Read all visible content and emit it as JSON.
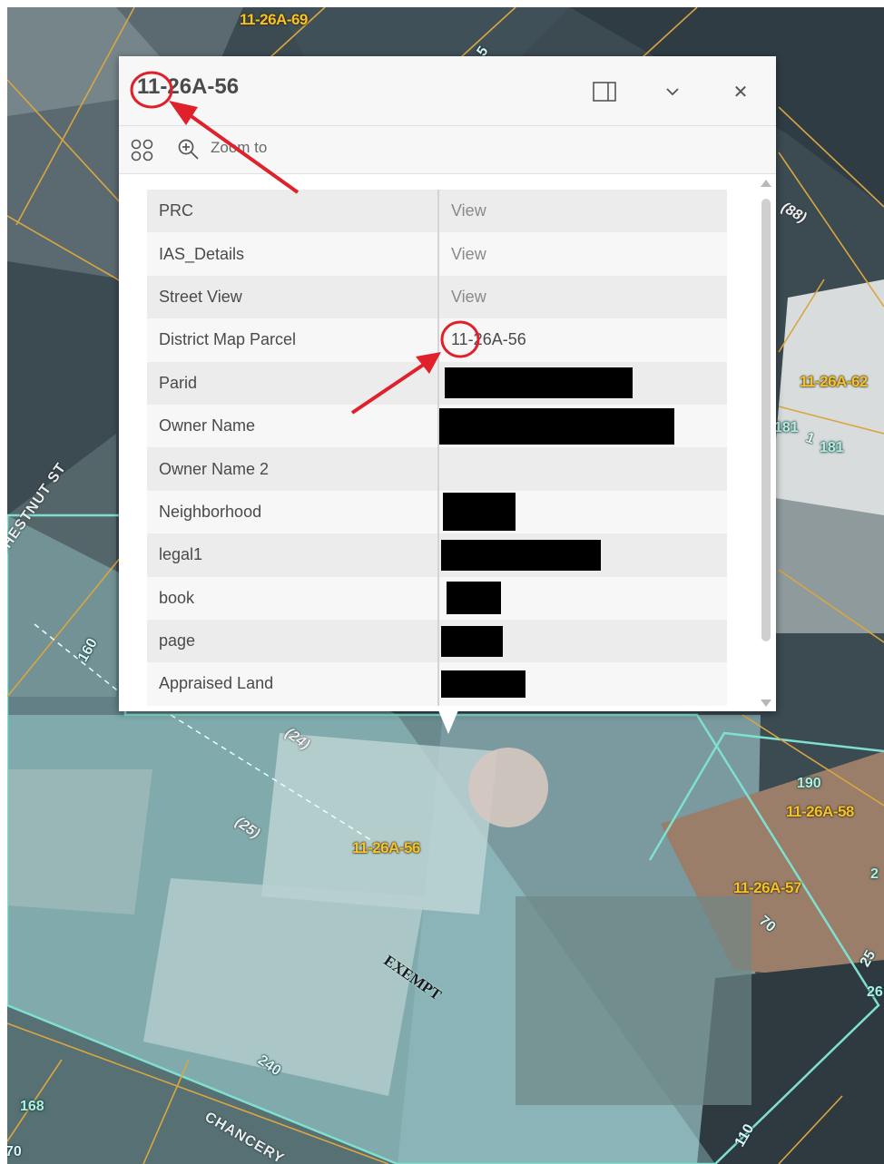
{
  "map": {
    "parcel_labels": [
      "11-26A-69",
      "11-26A-62",
      "11-26A-56",
      "11-26A-58",
      "11-26A-57"
    ],
    "address_labels": [
      "181",
      "181",
      "190",
      "168",
      "70",
      "70",
      "25",
      "26",
      "2",
      "5",
      "1"
    ],
    "lot_labels": [
      "(88)",
      "(24)",
      "(25)"
    ],
    "street_labels": [
      "CHESTNUT ST",
      "CHANCERY"
    ],
    "number_labels": [
      "160",
      "240",
      "110"
    ],
    "exempt_label": "EXEMPT"
  },
  "popup": {
    "title": "11-26A-56",
    "dock_icon": "dock-side-icon",
    "collapse_icon": "chevron-down-icon",
    "close_icon": "close-icon",
    "close_glyph": "✕",
    "toolbar": {
      "actions_icon": "actions-grid-icon",
      "zoom_icon": "zoom-in-icon",
      "zoom_label": "Zoom to"
    },
    "rows": [
      {
        "key": "PRC",
        "value": "View"
      },
      {
        "key": "IAS_Details",
        "value": "View"
      },
      {
        "key": "Street View",
        "value": "View"
      },
      {
        "key": "District Map Parcel",
        "value": "11-26A-56"
      },
      {
        "key": "Parid",
        "value": ""
      },
      {
        "key": "Owner Name",
        "value": ""
      },
      {
        "key": "Owner Name 2",
        "value": ""
      },
      {
        "key": "Neighborhood",
        "value": ""
      },
      {
        "key": "legal1",
        "value": ""
      },
      {
        "key": "book",
        "value": ""
      },
      {
        "key": "page",
        "value": ""
      },
      {
        "key": "Appraised Land",
        "value": ""
      }
    ]
  },
  "colors": {
    "annotation_red": "#e0202a",
    "parcel_line": "#d9a640",
    "selected_outline": "#7fe0d0",
    "label_yellow": "#f2c230"
  }
}
